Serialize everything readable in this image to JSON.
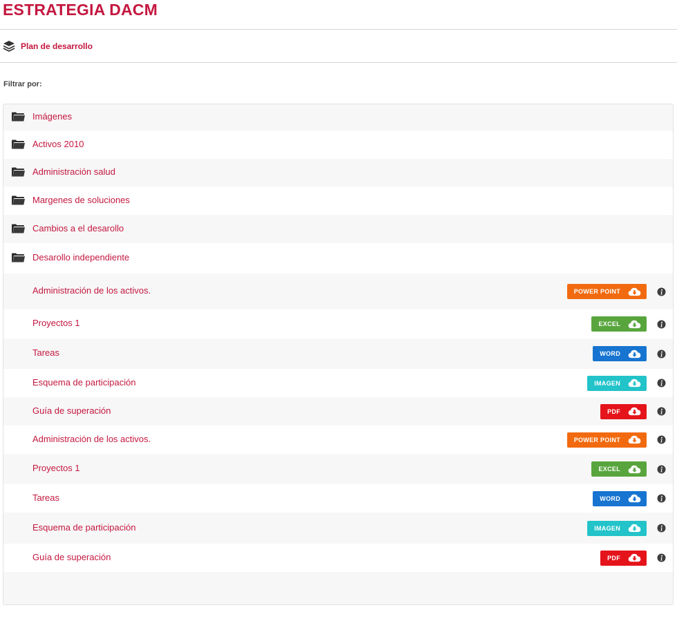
{
  "page": {
    "title": "ESTRATEGIA DACM",
    "breadcrumb": "Plan de desarrollo",
    "filter_label": "Filtrar por:"
  },
  "folders": [
    {
      "label": "Imágenes",
      "icon": "folder-icon"
    },
    {
      "label": "Activos 2010",
      "icon": "folder-icon"
    },
    {
      "label": "Administración salud",
      "icon": "folder-icon"
    },
    {
      "label": "Margenes de soluciones",
      "icon": "folder-icon"
    },
    {
      "label": "Cambios a el desarollo",
      "icon": "folder-icon"
    },
    {
      "label": "Desarollo independiente",
      "icon": "folder-icon"
    }
  ],
  "files": [
    {
      "label": "Administración de los activos.",
      "type": "POWER POINT",
      "color": "#f26a0f"
    },
    {
      "label": "Proyectos 1",
      "type": "EXCEL",
      "color": "#58a53d"
    },
    {
      "label": "Tareas",
      "type": "WORD",
      "color": "#1774d0"
    },
    {
      "label": "Esquema de participación",
      "type": "IMAGEN",
      "color": "#22c3c9"
    },
    {
      "label": "Guía de superación",
      "type": "PDF",
      "color": "#e5141b"
    },
    {
      "label": "Administración de los activos.",
      "type": "POWER POINT",
      "color": "#f26a0f"
    },
    {
      "label": "Proyectos 1",
      "type": "EXCEL",
      "color": "#58a53d"
    },
    {
      "label": "Tareas",
      "type": "WORD",
      "color": "#1774d0"
    },
    {
      "label": "Esquema de participación",
      "type": "IMAGEN",
      "color": "#22c3c9"
    },
    {
      "label": "Guía de superación",
      "type": "PDF",
      "color": "#e5141b"
    }
  ],
  "icons": {
    "breadcrumb": "layers-icon",
    "download": "cloud-download-icon",
    "info": "info-icon"
  },
  "colors": {
    "accent": "#c4173f"
  }
}
